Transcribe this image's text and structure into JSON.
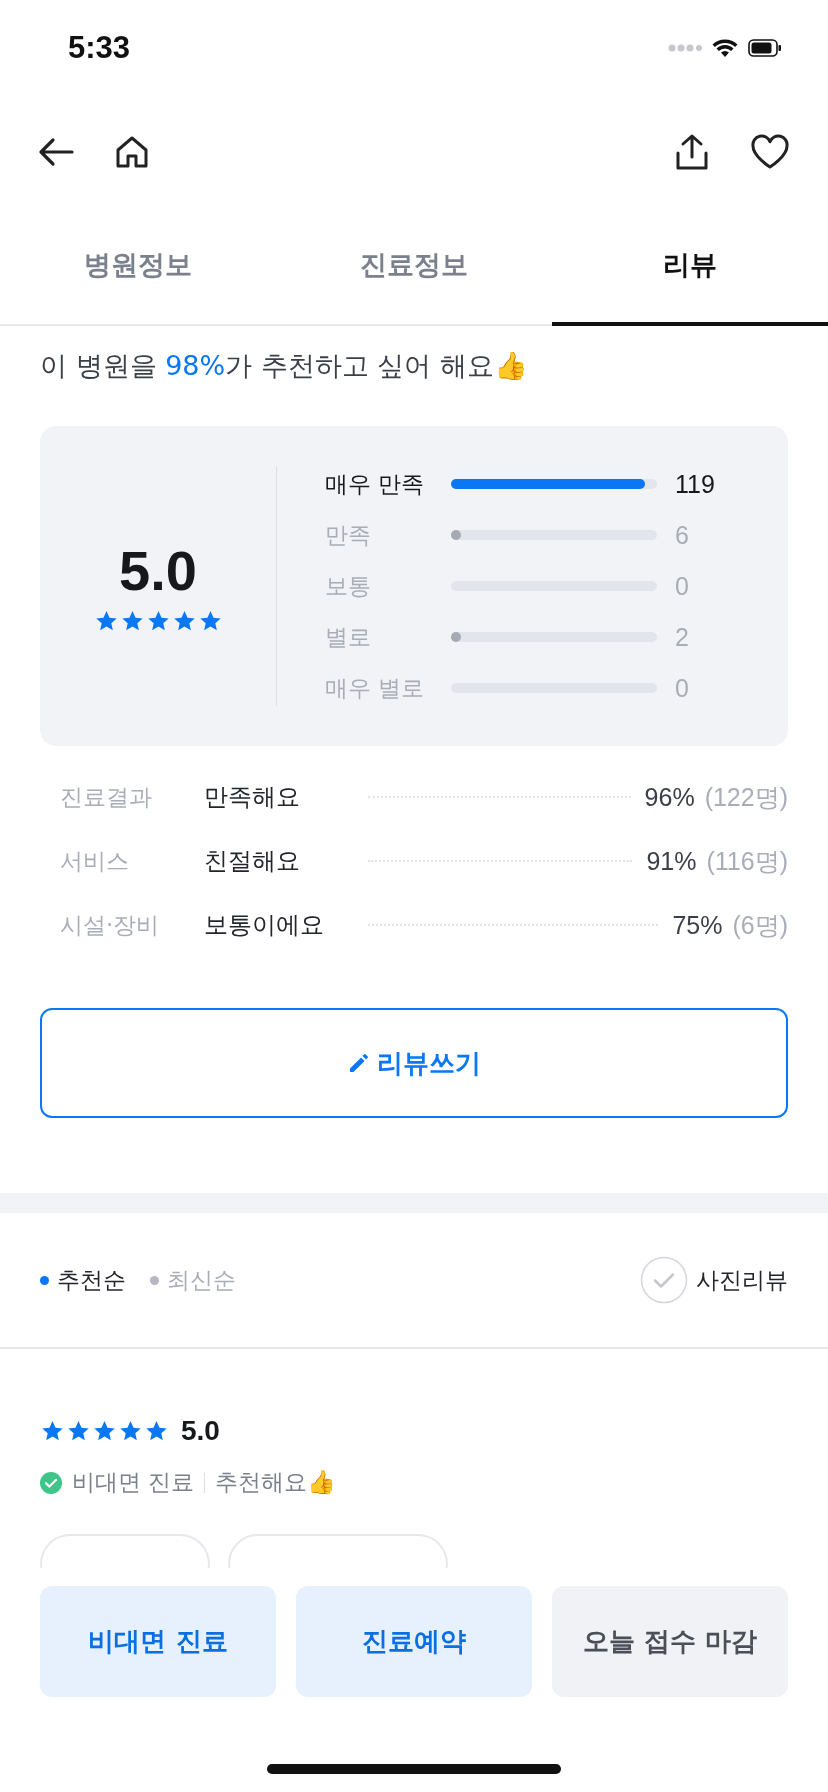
{
  "status_bar": {
    "time": "5:33"
  },
  "tabs": [
    {
      "label": "병원정보",
      "selected": false
    },
    {
      "label": "진료정보",
      "selected": false
    },
    {
      "label": "리뷰",
      "selected": true
    }
  ],
  "headline": [
    {
      "text": "이 병원을 ",
      "highlight": false
    },
    {
      "text": "98%",
      "highlight": true
    },
    {
      "text": "가 추천하고 싶어 해요👍",
      "highlight": false
    }
  ],
  "summary": {
    "score": "5.0",
    "stars": 5,
    "distribution": [
      {
        "label": "매우 만족",
        "level": 0.94,
        "count": "119",
        "highlighted": true
      },
      {
        "label": "만족",
        "level": 0.05,
        "count": "6",
        "highlighted": false
      },
      {
        "label": "보통",
        "count": "0",
        "highlighted": false
      },
      {
        "label": "별로",
        "level": 0.05,
        "count": "2",
        "highlighted": false
      },
      {
        "label": "매우 별로",
        "count": "0",
        "highlighted": false
      }
    ]
  },
  "attributes": [
    {
      "category": "진료결과",
      "answer": "만족해요",
      "percent": "96%",
      "count": "(122명)"
    },
    {
      "category": "서비스",
      "answer": "친절해요",
      "percent": "91%",
      "count": "(116명)"
    },
    {
      "category": "시설·장비",
      "answer": "보통이에요",
      "percent": "75%",
      "count": "(6명)"
    }
  ],
  "write_button": "리뷰쓰기",
  "sort_options": [
    {
      "label": "추천순",
      "selected": true
    },
    {
      "label": "최신순",
      "selected": false
    }
  ],
  "photo_review": {
    "label": "사진리뷰",
    "checked": false
  },
  "review": {
    "stars": 5,
    "score": "5.0",
    "verified": true,
    "visit_type": "비대면 진료",
    "recommendation": "추천해요👍"
  },
  "bottom_buttons": [
    {
      "label": "비대면 진료",
      "disabled": false
    },
    {
      "label": "진료예약",
      "disabled": false
    },
    {
      "label": "오늘 접수 마감",
      "disabled": true
    }
  ]
}
